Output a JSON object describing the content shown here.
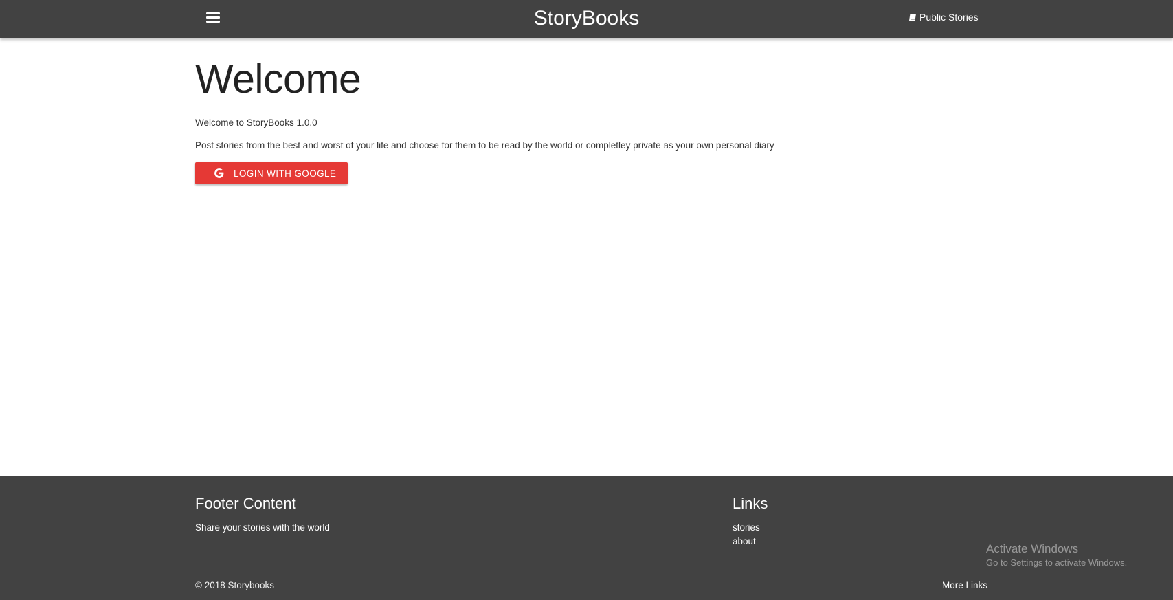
{
  "navbar": {
    "brand": "StoryBooks",
    "menu_icon": "hamburger-menu-icon",
    "public_stories_icon": "book-icon",
    "public_stories_label": "Public Stories"
  },
  "main": {
    "title": "Welcome",
    "intro": "Welcome to StoryBooks 1.0.0",
    "description": "Post stories from the best and worst of your life and choose for them to be read by the world or completley private as your own personal diary",
    "login_button": {
      "icon": "google-icon",
      "label": "LOGIN WITH GOOGLE"
    }
  },
  "footer": {
    "content_heading": "Footer Content",
    "content_text": "Share your stories with the world",
    "links_heading": "Links",
    "links": [
      "stories",
      "about"
    ],
    "copyright": "© 2018 Storybooks",
    "more_links": "More Links"
  },
  "watermark": {
    "title": "Activate Windows",
    "subtitle": "Go to Settings to activate Windows."
  },
  "colors": {
    "navbar_bg": "#424242",
    "footer_bg": "#424242",
    "button_red": "#e53935",
    "text_white": "#ffffff"
  }
}
